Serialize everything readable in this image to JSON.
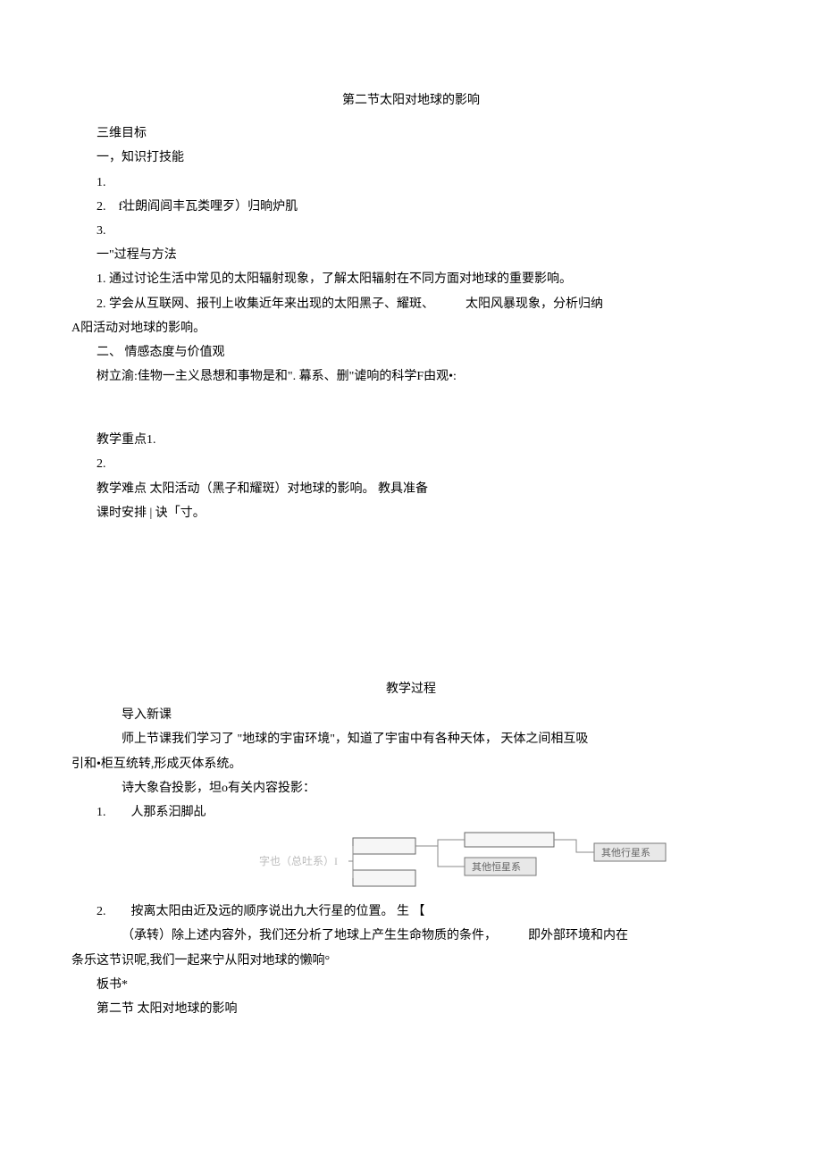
{
  "title": "第二节太阳对地球的影响",
  "sec1_hdr": "三维目标",
  "sec1_a": "一，知识打技能",
  "sec1_a1": "1.",
  "sec1_a2": "2.　f壮朗阎闾丰瓦类哩歹）归晌炉肌",
  "sec1_a3": "3.",
  "sec1_b": "一\"过程与方法",
  "sec1_b1": "1. 通过讨论生活中常见的太阳辐射现象，了解太阳辐射在不同方面对地球的重要影响。",
  "sec1_b2": "2. 学会从互联网、报刊上收集近年来出现的太阳黑子、耀斑、　　　太阳风暴现象，分析归纳",
  "sec1_b2_cont": "A阳活动对地球的影响。",
  "sec1_c": "二、 情感态度与价值观",
  "sec1_c1": "树立渝:佳物一主义恳想和事物是和\". 幕系、删\"谑响的科学F由观•:",
  "keypoint_hdr": "教学重点1.",
  "keypoint_2": "2.",
  "difficulty": " 教学难点 太阳活动（黑子和耀斑）对地球的影响。 教具准备",
  "schedule": "课时安排 | 诀「寸。",
  "process_title": "教学过程",
  "intro_hdr": "导入新课",
  "intro_p1": "师上节课我们学习了 \"地球的宇宙环境\"，知道了宇宙中有各种天体， 天体之间相互吸",
  "intro_p1_cont": "引和•柜互统转,形成灭体系统。",
  "intro_p2": "诗大象旮投影，坦o有关内容投影：",
  "intro_q1": "1.　　人那系汩脚乩",
  "diagram_label": "字也（总吐系）I",
  "diagram_box1": "其他恒星系",
  "diagram_box2": "其他行星系",
  "intro_q2": "2.　　按离太阳由近及远的顺序说出九大行星的位置。 生 【",
  "transition_p1": "（承转）除上述内容外，我们还分析了地球上产生生命物质的条件，　　　即外部环境和内在",
  "transition_p1_cont": "条乐这节识呢,我们一起来宁从阳对地球的懒响°",
  "board_hdr": "板书*",
  "board_line": "第二节 太阳对地球的影响"
}
